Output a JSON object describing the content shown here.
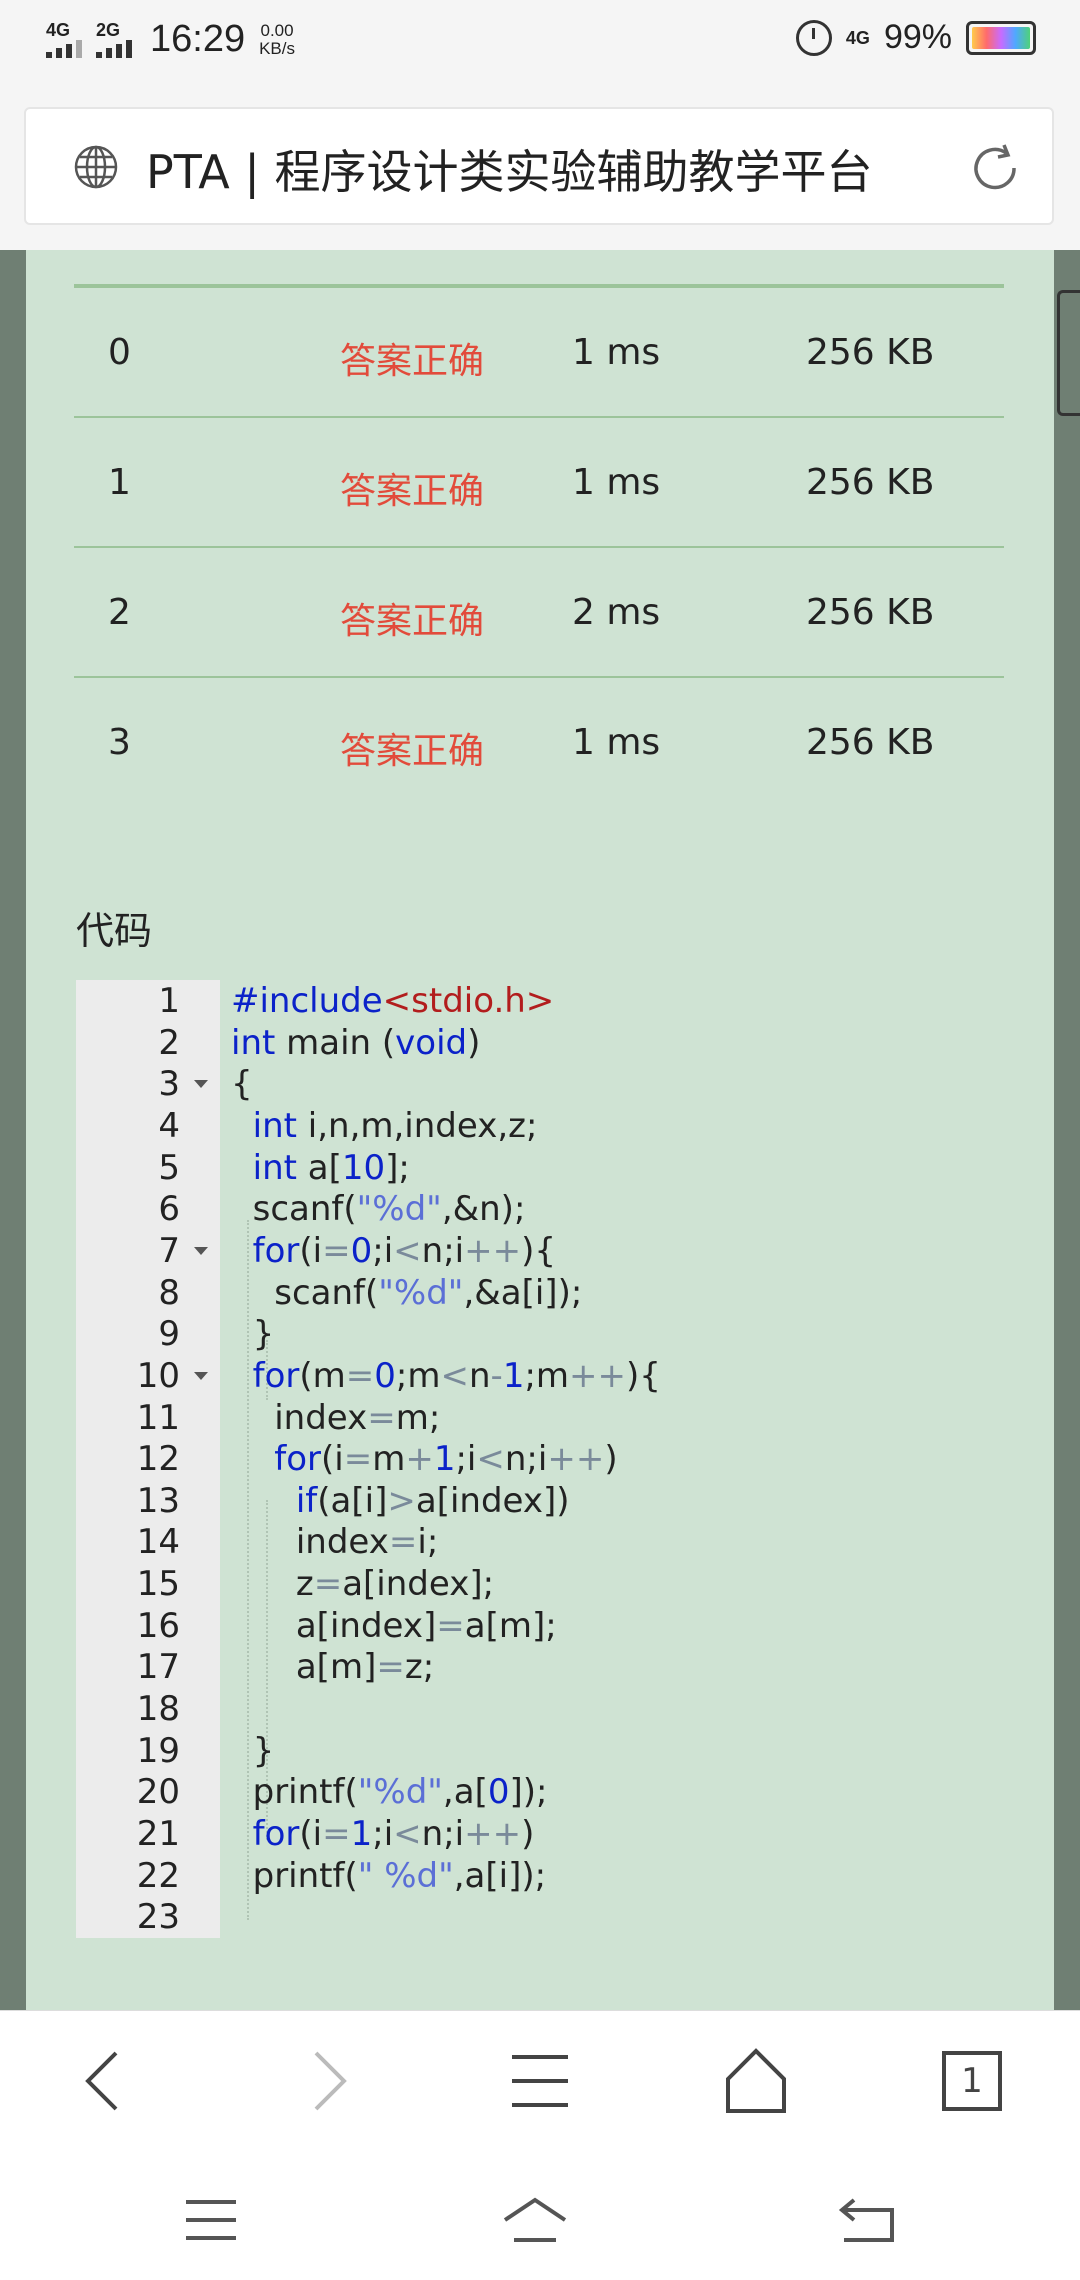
{
  "status_bar": {
    "signal1": "4G",
    "signal2": "2G",
    "time": "16:29",
    "net_speed_value": "0.00",
    "net_speed_unit": "KB/s",
    "net_type": "4G",
    "battery_percent": "99%",
    "battery_level": 0.99
  },
  "address_bar": {
    "title": "PTA | 程序设计类实验辅助教学平台"
  },
  "results": [
    {
      "case": "0",
      "result": "答案正确",
      "time": "1 ms",
      "memory": "256 KB"
    },
    {
      "case": "1",
      "result": "答案正确",
      "time": "1 ms",
      "memory": "256 KB"
    },
    {
      "case": "2",
      "result": "答案正确",
      "time": "2 ms",
      "memory": "256 KB"
    },
    {
      "case": "3",
      "result": "答案正确",
      "time": "1 ms",
      "memory": "256 KB"
    }
  ],
  "code_section": {
    "title": "代码",
    "lines": [
      {
        "n": "1",
        "fold": false,
        "text": "#include<stdio.h>"
      },
      {
        "n": "2",
        "fold": false,
        "text": "int main (void)"
      },
      {
        "n": "3",
        "fold": true,
        "text": "{"
      },
      {
        "n": "4",
        "fold": false,
        "text": "  int i,n,m,index,z;"
      },
      {
        "n": "5",
        "fold": false,
        "text": "  int a[10];"
      },
      {
        "n": "6",
        "fold": false,
        "text": "  scanf(\"%d\",&n);"
      },
      {
        "n": "7",
        "fold": true,
        "text": "  for(i=0;i<n;i++){"
      },
      {
        "n": "8",
        "fold": false,
        "text": "    scanf(\"%d\",&a[i]);"
      },
      {
        "n": "9",
        "fold": false,
        "text": "  }"
      },
      {
        "n": "10",
        "fold": true,
        "text": "  for(m=0;m<n-1;m++){"
      },
      {
        "n": "11",
        "fold": false,
        "text": "    index=m;"
      },
      {
        "n": "12",
        "fold": false,
        "text": "    for(i=m+1;i<n;i++)"
      },
      {
        "n": "13",
        "fold": false,
        "text": "      if(a[i]>a[index])"
      },
      {
        "n": "14",
        "fold": false,
        "text": "      index=i;"
      },
      {
        "n": "15",
        "fold": false,
        "text": "      z=a[index];"
      },
      {
        "n": "16",
        "fold": false,
        "text": "      a[index]=a[m];"
      },
      {
        "n": "17",
        "fold": false,
        "text": "      a[m]=z;"
      },
      {
        "n": "18",
        "fold": false,
        "text": ""
      },
      {
        "n": "19",
        "fold": false,
        "text": "  }"
      },
      {
        "n": "20",
        "fold": false,
        "text": "  printf(\"%d\",a[0]);"
      },
      {
        "n": "21",
        "fold": false,
        "text": "  for(i=1;i<n;i++)"
      },
      {
        "n": "22",
        "fold": false,
        "text": "  printf(\" %d\",a[i]);"
      },
      {
        "n": "23",
        "fold": false,
        "text": ""
      }
    ]
  },
  "bottom_nav": {
    "tabs_count": "1"
  },
  "colors": {
    "panel_bg": "#cfe3d3",
    "result_ok": "#e24b3b",
    "keyword": "#0b22c9",
    "string": "#5b6fd6",
    "include_header": "#b21d1d"
  }
}
